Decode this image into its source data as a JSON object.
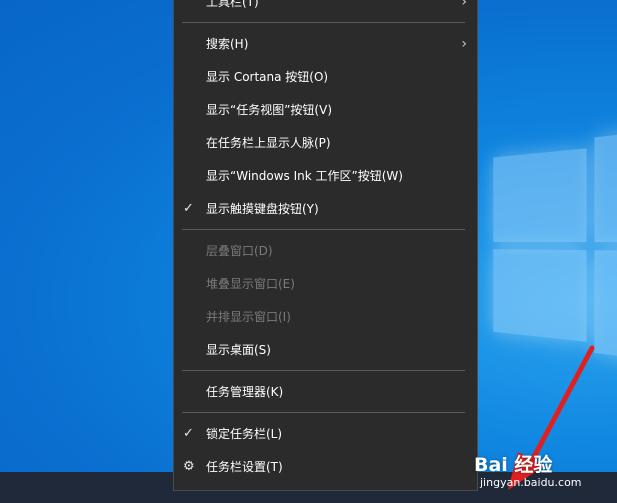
{
  "menu": {
    "items": [
      {
        "label": "工具栏(T)",
        "submenu": true
      },
      {
        "label": "搜索(H)",
        "submenu": true
      },
      {
        "label": "显示 Cortana 按钮(O)"
      },
      {
        "label": "显示“任务视图”按钮(V)"
      },
      {
        "label": "在任务栏上显示人脉(P)"
      },
      {
        "label": "显示“Windows Ink 工作区”按钮(W)"
      },
      {
        "label": "显示触摸键盘按钮(Y)",
        "checked": true
      },
      {
        "label": "层叠窗口(D)",
        "disabled": true
      },
      {
        "label": "堆叠显示窗口(E)",
        "disabled": true
      },
      {
        "label": "并排显示窗口(I)",
        "disabled": true
      },
      {
        "label": "显示桌面(S)"
      },
      {
        "label": "任务管理器(K)"
      },
      {
        "label": "锁定任务栏(L)",
        "checked": true
      },
      {
        "label": "任务栏设置(T)",
        "icon": "gear-icon"
      }
    ]
  },
  "watermark": {
    "brand": "Bai 经验",
    "url": "jingyan.baidu.com"
  },
  "colors": {
    "menu_bg": "#2b2b2b",
    "desktop": "#0a78d7",
    "arrow": "#e02020"
  }
}
